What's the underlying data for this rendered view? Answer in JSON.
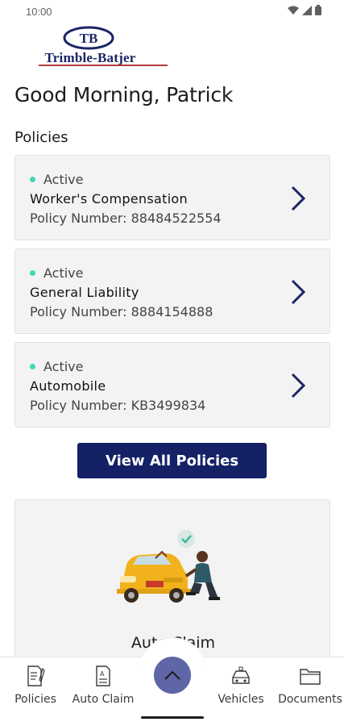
{
  "status_bar": {
    "time": "10:00",
    "icons": [
      "wifi-icon",
      "signal-icon",
      "battery-icon"
    ]
  },
  "logo": {
    "monogram": "TB",
    "wordmark": "Trimble-Batjer",
    "colors": {
      "navy": "#1b2566",
      "red": "#b23a3a"
    }
  },
  "greeting": "Good Morning, Patrick",
  "policies": {
    "title": "Policies",
    "items": [
      {
        "status": "Active",
        "name": "Worker's Compensation",
        "number_label": "Policy Number: 88484522554"
      },
      {
        "status": "Active",
        "name": "General Liability",
        "number_label": "Policy Number: 8884154888"
      },
      {
        "status": "Active",
        "name": "Automobile",
        "number_label": "Policy Number: KB3499834"
      }
    ],
    "status_color": "#3fd6b8",
    "view_all_label": "View All Policies"
  },
  "claim_card": {
    "label": "Auto Claim",
    "illustration": "car-repair-illustration"
  },
  "bottom_nav": {
    "items": [
      {
        "label": "Policies",
        "icon": "policy-document-icon"
      },
      {
        "label": "Auto Claim",
        "icon": "claim-form-icon"
      },
      {
        "label": "Vehicles",
        "icon": "car-icon"
      },
      {
        "label": "Documents",
        "icon": "folder-icon"
      }
    ],
    "center_icon": "chevron-up-icon"
  },
  "colors": {
    "primary": "#142166",
    "accent": "#5e66a8",
    "card_bg": "#f3f3f4"
  }
}
